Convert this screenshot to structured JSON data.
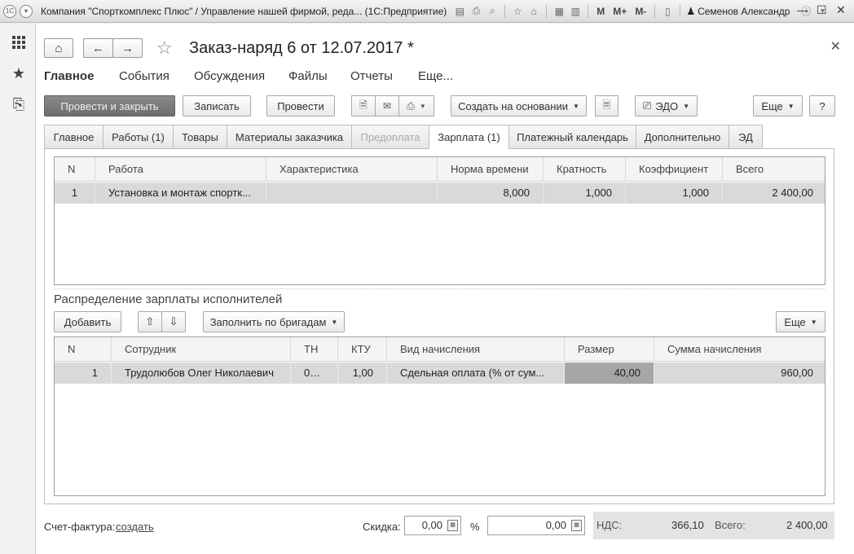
{
  "window": {
    "title": "Компания \"Спорткомплекс Плюс\" / Управление нашей фирмой, реда...  (1С:Предприятие)",
    "user": "Семенов Александр",
    "toolbar_buttons": [
      "M",
      "M+",
      "M-"
    ]
  },
  "form": {
    "title": "Заказ-наряд 6 от 12.07.2017 *",
    "subnav": [
      "Главное",
      "События",
      "Обсуждения",
      "Файлы",
      "Отчеты",
      "Еще..."
    ],
    "commands": {
      "post_close": "Провести и закрыть",
      "save": "Записать",
      "post": "Провести",
      "create_based": "Создать на основании",
      "edo": "ЭДО",
      "more": "Еще",
      "help": "?"
    },
    "tabs": [
      {
        "label": "Главное",
        "state": "normal"
      },
      {
        "label": "Работы (1)",
        "state": "normal"
      },
      {
        "label": "Товары",
        "state": "normal"
      },
      {
        "label": "Материалы заказчика",
        "state": "normal"
      },
      {
        "label": "Предоплата",
        "state": "disabled"
      },
      {
        "label": "Зарплата (1)",
        "state": "active"
      },
      {
        "label": "Платежный календарь",
        "state": "normal"
      },
      {
        "label": "Дополнительно",
        "state": "normal"
      },
      {
        "label": "ЭД",
        "state": "normal"
      }
    ]
  },
  "works_table": {
    "columns": [
      "N",
      "Работа",
      "Характеристика",
      "Норма времени",
      "Кратность",
      "Коэффициент",
      "Всего"
    ],
    "rows": [
      {
        "n": "1",
        "work": "Установка и монтаж спортк...",
        "characteristic": "",
        "norm": "8,000",
        "multiplicity": "1,000",
        "coefficient": "1,000",
        "total": "2 400,00"
      }
    ]
  },
  "salary": {
    "section_title": "Распределение зарплаты исполнителей",
    "add": "Добавить",
    "fill_by_teams": "Заполнить по бригадам",
    "more": "Еще",
    "columns": [
      "N",
      "Сотрудник",
      "ТН",
      "КТУ",
      "Вид начисления",
      "Размер",
      "Сумма начисления"
    ],
    "rows": [
      {
        "n": "1",
        "employee": "Трудолюбов Олег Николаевич",
        "tn": "00...",
        "ktu": "1,00",
        "accrual_type": "Сдельная оплата (% от сум...",
        "size": "40,00",
        "amount": "960,00"
      }
    ]
  },
  "footer": {
    "invoice_label": "Счет-фактура:",
    "invoice_link": "создать",
    "discount_label": "Скидка:",
    "discount_value": "0,00",
    "percent_sign": "%",
    "discount_amount": "0,00",
    "vat_label": "НДС:",
    "vat_value": "366,10",
    "total_label": "Всего:",
    "total_value": "2 400,00"
  }
}
